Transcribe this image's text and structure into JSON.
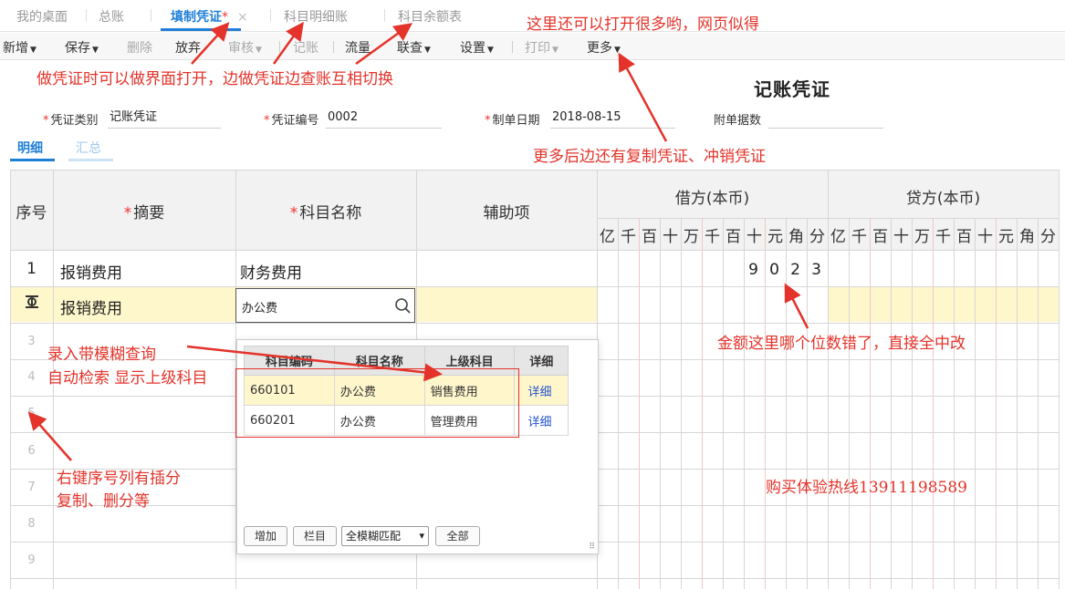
{
  "tabs": [
    {
      "label": "我的桌面"
    },
    {
      "label": "总账"
    },
    {
      "label": "填制凭证",
      "modified_mark": "*",
      "close": "×"
    },
    {
      "label": "科目明细账"
    },
    {
      "label": "科目余额表"
    }
  ],
  "toolbar": {
    "items": [
      "新增",
      "保存",
      "删除",
      "放弃",
      "审核",
      "记账",
      "流量",
      "联查",
      "设置",
      "打印",
      "更多"
    ]
  },
  "voucher": {
    "title": "记账凭证",
    "type_label": "凭证类别",
    "type_value": "记账凭证",
    "number_label": "凭证编号",
    "number_value": "0002",
    "date_label": "制单日期",
    "date_value": "2018-08-15",
    "attach_label": "附单据数",
    "attach_value": ""
  },
  "subtabs": [
    "明细",
    "汇总"
  ],
  "grid": {
    "headers": {
      "seq": "序号",
      "summary": "摘要",
      "account": "科目名称",
      "aux": "辅助项",
      "debit": "借方(本币)",
      "credit": "贷方(本币)",
      "req_mark": "*"
    },
    "digits": [
      "亿",
      "千",
      "百",
      "十",
      "万",
      "千",
      "百",
      "十",
      "元",
      "角",
      "分"
    ],
    "rows": [
      {
        "seq": "1",
        "summary": "报销费用",
        "account": "财务费用",
        "debit_digits": [
          "9",
          "0",
          "2",
          "3"
        ]
      },
      {
        "seq": "",
        "summary": "报销费用",
        "account": "办公费"
      },
      {
        "seq": "3"
      },
      {
        "seq": "4"
      },
      {
        "seq": "5"
      },
      {
        "seq": "6"
      },
      {
        "seq": "7"
      },
      {
        "seq": "8"
      },
      {
        "seq": "9"
      }
    ]
  },
  "dropdown": {
    "headers": [
      "科目编码",
      "科目名称",
      "上级科目",
      "详细"
    ],
    "rows": [
      {
        "code": "660101",
        "name": "办公费",
        "parent": "销售费用",
        "detail": "详细"
      },
      {
        "code": "660201",
        "name": "办公费",
        "parent": "管理费用",
        "detail": "详细"
      }
    ],
    "buttons": {
      "add": "增加",
      "columns": "栏目",
      "all": "全部"
    },
    "match_mode": "全模糊匹配"
  },
  "annotations": {
    "a1": "这里还可以打开很多哟，网页似得",
    "a2": "做凭证时可以做界面打开，边做凭证边查账互相切换",
    "a3": "更多后边还有复制凭证、冲销凭证",
    "a4": "金额这里哪个位数错了，直接全中改",
    "a5_line1": "录入带模糊查询",
    "a5_line2": "自动检索  显示上级科目",
    "a6_line1": "右键序号列有插分",
    "a6_line2": "复制、删分等",
    "a7": "购买体验热线13911198589"
  },
  "colors": {
    "accent": "#1f7fd6",
    "annotation": "#e3332a",
    "highlight_row": "#fff7cc"
  }
}
